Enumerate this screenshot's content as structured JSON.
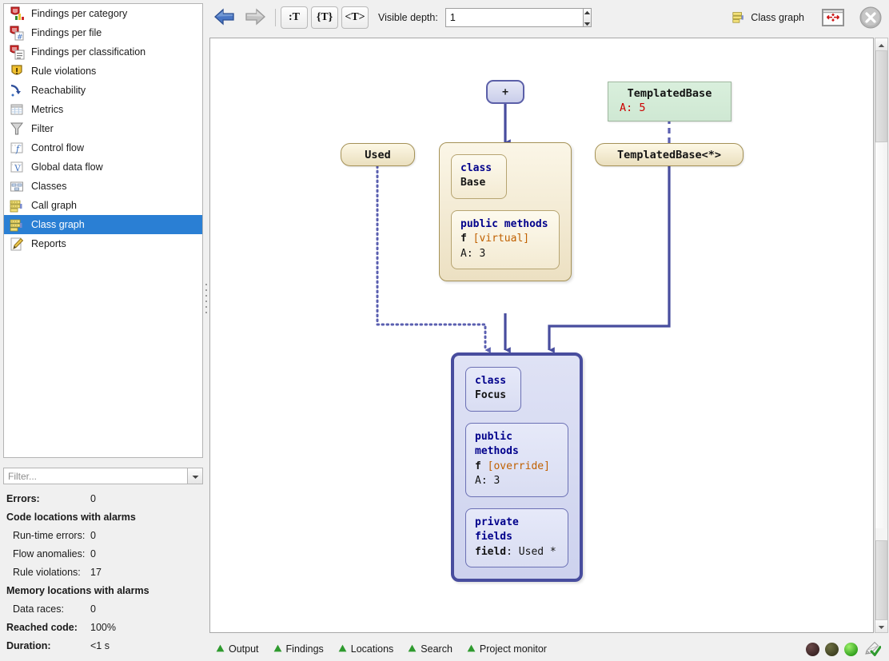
{
  "sidebar": {
    "items": [
      {
        "label": "Findings per category",
        "icon": "findings-category-icon",
        "selected": false
      },
      {
        "label": "Findings per file",
        "icon": "findings-file-icon",
        "selected": false
      },
      {
        "label": "Findings per classification",
        "icon": "findings-classification-icon",
        "selected": false
      },
      {
        "label": "Rule violations",
        "icon": "shield-warning-icon",
        "selected": false
      },
      {
        "label": "Reachability",
        "icon": "reachability-arrow-icon",
        "selected": false
      },
      {
        "label": "Metrics",
        "icon": "metrics-table-icon",
        "selected": false
      },
      {
        "label": "Filter",
        "icon": "funnel-icon",
        "selected": false
      },
      {
        "label": "Control flow",
        "icon": "control-flow-icon",
        "selected": false
      },
      {
        "label": "Global data flow",
        "icon": "global-data-flow-icon",
        "selected": false
      },
      {
        "label": "Classes",
        "icon": "classes-icon",
        "selected": false
      },
      {
        "label": "Call graph",
        "icon": "call-graph-icon",
        "selected": false
      },
      {
        "label": "Class graph",
        "icon": "class-graph-icon",
        "selected": true
      },
      {
        "label": "Reports",
        "icon": "pencil-report-icon",
        "selected": false
      }
    ],
    "selected_accent": "#2a7fd4"
  },
  "filter": {
    "placeholder": "Filter...",
    "value": "",
    "dropdown_icon": "chevron-down-icon"
  },
  "stats": {
    "rows": [
      {
        "key": "Errors:",
        "value": "0",
        "bold": true,
        "indent": false
      },
      {
        "key": "Code locations with alarms",
        "value": "",
        "bold": true,
        "indent": false
      },
      {
        "key": "Run-time errors:",
        "value": "0",
        "bold": false,
        "indent": true
      },
      {
        "key": "Flow anomalies:",
        "value": "0",
        "bold": false,
        "indent": true
      },
      {
        "key": "Rule violations:",
        "value": "17",
        "bold": false,
        "indent": true
      },
      {
        "key": "Memory locations with alarms",
        "value": "",
        "bold": true,
        "indent": false
      },
      {
        "key": "Data races:",
        "value": "0",
        "bold": false,
        "indent": true
      },
      {
        "key": "Reached code:",
        "value": "100%",
        "bold": true,
        "indent": false
      },
      {
        "key": "Duration:",
        "value": "<1 s",
        "bold": true,
        "indent": false
      }
    ]
  },
  "toolbar": {
    "back_icon": "back-arrow-icon",
    "forward_icon": "forward-arrow-icon",
    "buttons": [
      {
        "label": ":T",
        "name": "show-qualified-names-button"
      },
      {
        "label": "{T}",
        "name": "show-namespaces-button"
      },
      {
        "label": "<T>",
        "name": "show-templates-button"
      }
    ],
    "depth_label": "Visible depth:",
    "depth_value": "1",
    "title": "Class graph",
    "title_icon": "class-graph-icon",
    "fit_icon": "fit-to-window-icon",
    "close_icon": "close-icon"
  },
  "graph": {
    "nodes": {
      "plus": {
        "label": "+"
      },
      "used": {
        "label": "Used"
      },
      "templated_base": {
        "name": "TemplatedBase",
        "attr": "A: 5"
      },
      "templated_base_inst": {
        "label": "TemplatedBase<*>"
      },
      "base": {
        "header_kind": "class",
        "header_name": "Base",
        "methods_title": "public methods",
        "method_name": "f",
        "method_tag": "[virtual]",
        "method_attr": "A: 3"
      },
      "focus": {
        "header_kind": "class",
        "header_name": "Focus",
        "methods_title": "public methods",
        "method_name": "f",
        "method_tag": "[override]",
        "method_attr": "A: 3",
        "fields_title": "private fields",
        "field_key": "field",
        "field_value": "Used *"
      }
    },
    "colors": {
      "edge": "#484d9e",
      "base_border": "#a59257",
      "focus_border": "#484d9e",
      "template_fill": "#cfe8d3",
      "alarm": "#cc0000",
      "keyword": "#00008b",
      "tag": "#c06000"
    }
  },
  "scrollbar": {
    "up_icon": "triangle-up-icon",
    "down_icon": "triangle-down-icon"
  },
  "statusbar": {
    "items": [
      {
        "label": "Output",
        "icon": "triangle-icon"
      },
      {
        "label": "Findings",
        "icon": "triangle-icon"
      },
      {
        "label": "Locations",
        "icon": "triangle-icon"
      },
      {
        "label": "Search",
        "icon": "triangle-icon"
      },
      {
        "label": "Project monitor",
        "icon": "triangle-icon"
      }
    ],
    "indicators": [
      {
        "name": "indicator-dark-red",
        "color": "#3a2424"
      },
      {
        "name": "indicator-olive",
        "color": "#3d3f20"
      },
      {
        "name": "indicator-green",
        "color": "#2a9a18"
      }
    ],
    "edit_check_icon": "pencil-check-icon"
  }
}
